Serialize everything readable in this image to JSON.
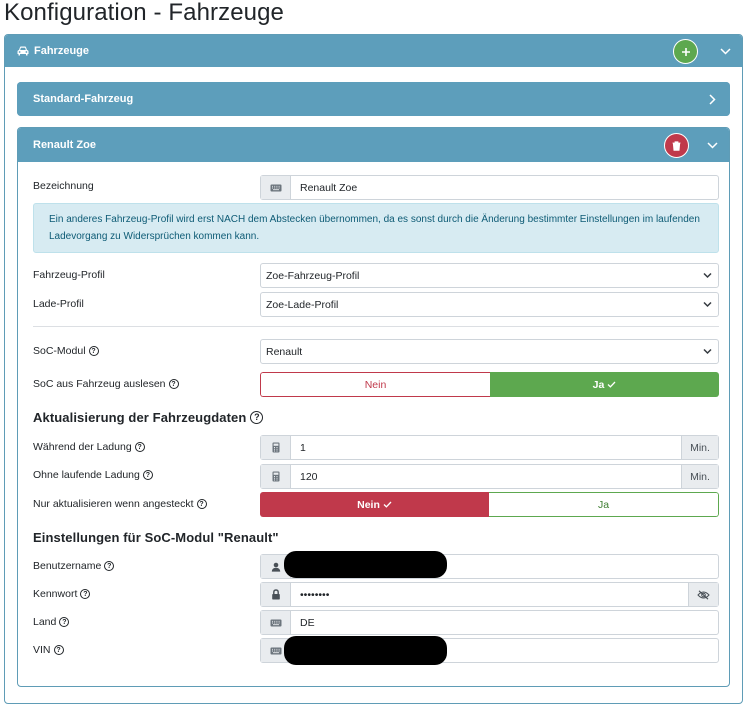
{
  "page_title": "Konfiguration - Fahrzeuge",
  "outer_card": {
    "title": "Fahrzeuge"
  },
  "standard_card": {
    "title": "Standard-Fahrzeug"
  },
  "vehicle_card": {
    "title": "Renault Zoe",
    "bezeichnung": {
      "label": "Bezeichnung",
      "value": "Renault Zoe"
    },
    "info_text": "Ein anderes Fahrzeug-Profil wird erst NACH dem Abstecken übernommen, da es sonst durch die Änderung bestimmter Einstellungen im laufenden Ladevorgang zu Widersprüchen kommen kann.",
    "fahrzeug_profil": {
      "label": "Fahrzeug-Profil",
      "value": "Zoe-Fahrzeug-Profil"
    },
    "lade_profil": {
      "label": "Lade-Profil",
      "value": "Zoe-Lade-Profil"
    },
    "soc_modul": {
      "label": "SoC-Modul",
      "value": "Renault"
    },
    "soc_auslesen": {
      "label": "SoC aus Fahrzeug auslesen",
      "no": "Nein",
      "yes": "Ja",
      "selected": "Ja"
    },
    "update_section": {
      "heading": "Aktualisierung der Fahrzeugdaten",
      "during_charge": {
        "label": "Während der Ladung",
        "value": "1",
        "unit": "Min."
      },
      "no_charge": {
        "label": "Ohne laufende Ladung",
        "value": "120",
        "unit": "Min."
      },
      "only_plugged": {
        "label": "Nur aktualisieren wenn angesteckt",
        "no": "Nein",
        "yes": "Ja",
        "selected": "Nein"
      }
    },
    "soc_settings": {
      "heading": "Einstellungen für SoC-Modul \"Renault\"",
      "username": {
        "label": "Benutzername"
      },
      "password": {
        "label": "Kennwort",
        "value": "••••••••"
      },
      "country": {
        "label": "Land",
        "value": "DE"
      },
      "vin": {
        "label": "VIN"
      }
    }
  },
  "colors": {
    "header": "#5d9ebb",
    "success": "#5da84f",
    "danger": "#c0394b",
    "info_bg": "#d7ebf2"
  }
}
